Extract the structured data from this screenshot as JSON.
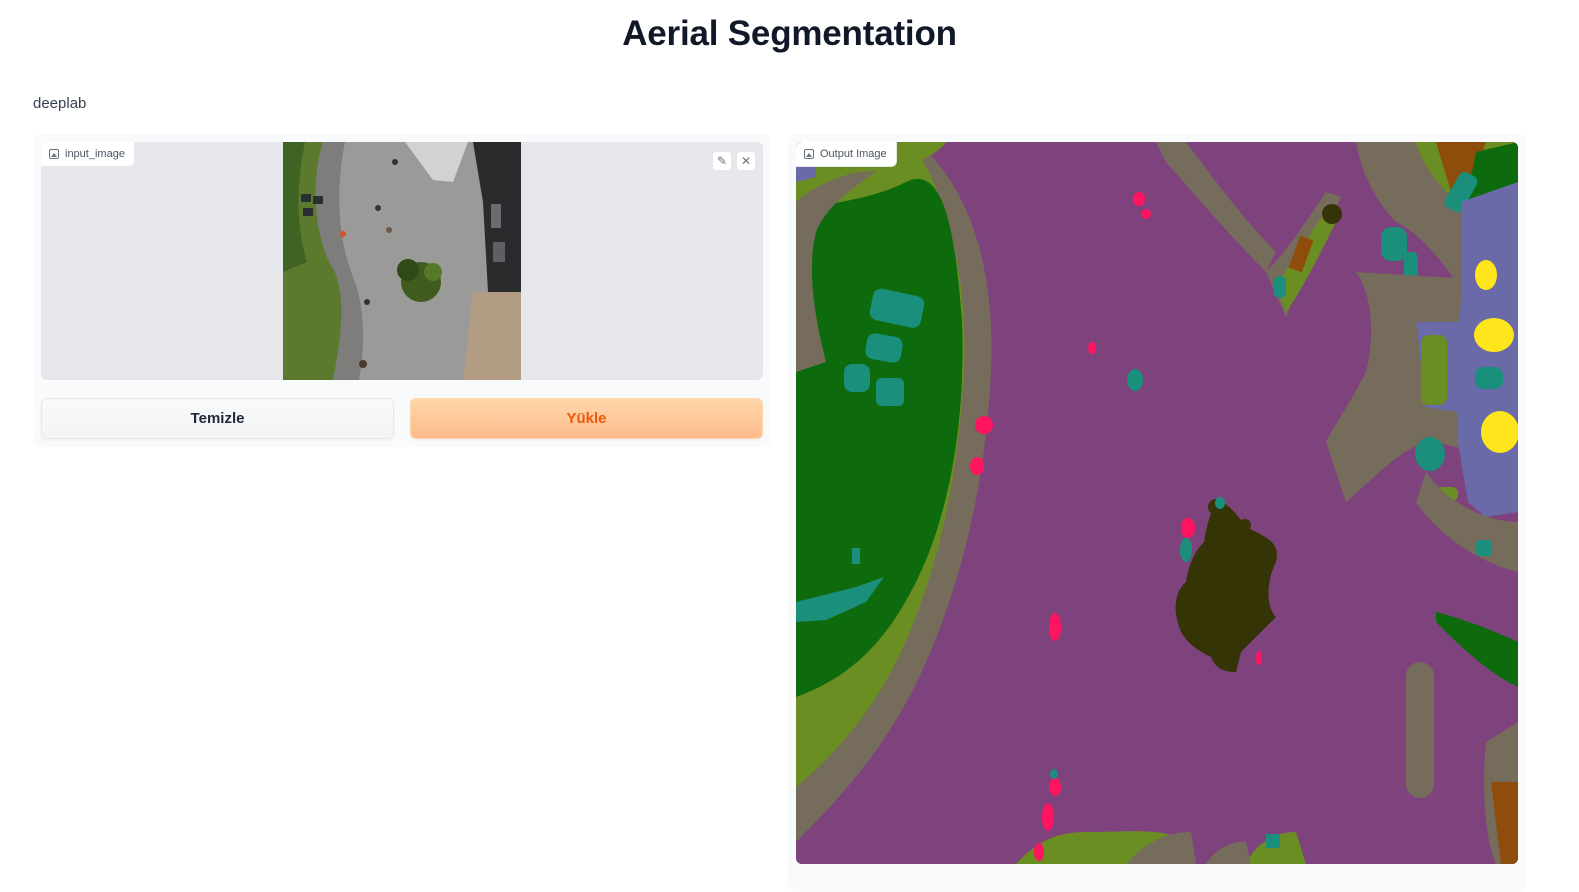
{
  "header": {
    "title": "Aerial Segmentation",
    "description": "deeplab"
  },
  "input": {
    "label": "input_image",
    "icon": "image-icon",
    "edit_icon": "pencil-icon",
    "clear_icon": "close-icon"
  },
  "buttons": {
    "clear_label": "Temizle",
    "submit_label": "Yükle"
  },
  "output": {
    "label": "Output Image",
    "icon": "image-icon"
  },
  "colors": {
    "accent": "#ea580c",
    "submit_bg": "#fdba8c",
    "seg_paved": "#7e437c",
    "seg_vegetation": "#0d6b0d",
    "seg_grass": "#6b8e23",
    "seg_dirt": "#766c5c",
    "seg_tree": "#353406",
    "seg_person": "#ff1460",
    "seg_car": "#1a8f7c",
    "seg_roof": "#6a6aa8",
    "seg_yellow": "#fee51c",
    "seg_brown": "#8f4d0c"
  }
}
